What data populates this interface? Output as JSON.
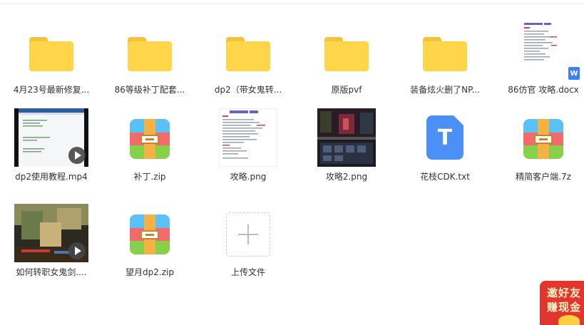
{
  "files": [
    {
      "name": "4月23号最新修复...",
      "type": "folder"
    },
    {
      "name": "86等级补丁配套...",
      "type": "folder"
    },
    {
      "name": "dp2（带女鬼转...",
      "type": "folder"
    },
    {
      "name": "原版pvf",
      "type": "folder"
    },
    {
      "name": "装备炫火删了NP...",
      "type": "folder"
    },
    {
      "name": "86仿官 攻略.docx",
      "type": "docx",
      "badge": "W"
    },
    {
      "name": "dp2使用教程.mp4",
      "type": "video"
    },
    {
      "name": "补丁.zip",
      "type": "zip"
    },
    {
      "name": "攻略.png",
      "type": "image"
    },
    {
      "name": "攻略2.png",
      "type": "image"
    },
    {
      "name": "花枝CDK.txt",
      "type": "txt",
      "glyph": "T"
    },
    {
      "name": "精简客户端.7z",
      "type": "zip"
    },
    {
      "name": "如何转职女鬼剑....",
      "type": "video"
    },
    {
      "name": "望月dp2.zip",
      "type": "zip"
    }
  ],
  "upload": {
    "label": "上传文件"
  },
  "promo": {
    "line1": "邀好友",
    "line2": "赚现金"
  },
  "colors": {
    "folder": "#ffd54a",
    "zip_top": "#5bc0f5",
    "zip_mid": "#f26b6b",
    "zip_bottom": "#86d04a",
    "txt": "#4a90f7",
    "promo": "#e4342d"
  }
}
